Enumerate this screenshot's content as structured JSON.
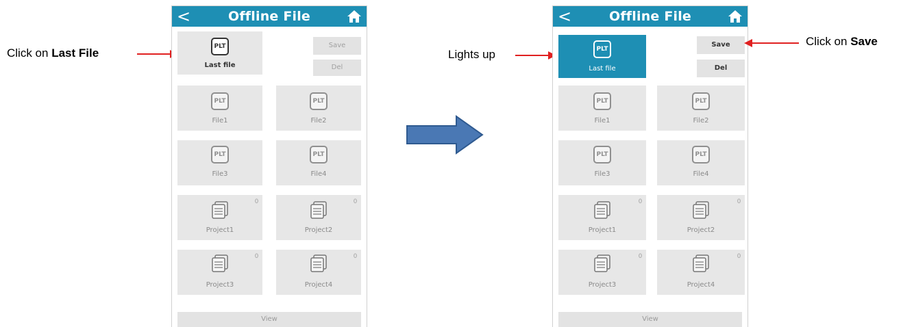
{
  "annotations": {
    "left_prefix": "Click on ",
    "left_bold": "Last File",
    "middle": "Lights up",
    "right_prefix": "Click on ",
    "right_bold": "Save"
  },
  "app": {
    "back_glyph": "<",
    "title": "Offline File",
    "home_icon": "home-icon",
    "last_file": {
      "icon_text": "PLT",
      "label": "Last file"
    },
    "save_label": "Save",
    "del_label": "Del",
    "files": [
      {
        "icon_text": "PLT",
        "label": "File1"
      },
      {
        "icon_text": "PLT",
        "label": "File2"
      },
      {
        "icon_text": "PLT",
        "label": "File3"
      },
      {
        "icon_text": "PLT",
        "label": "File4"
      }
    ],
    "projects": [
      {
        "label": "Project1",
        "count": "0"
      },
      {
        "label": "Project2",
        "count": "0"
      },
      {
        "label": "Project3",
        "count": "0"
      },
      {
        "label": "Project4",
        "count": "0"
      }
    ],
    "view_label": "View"
  },
  "colors": {
    "header": "#1e8fb4",
    "selected_tile": "#1e8fb4",
    "red_arrow": "#e02020",
    "transition_arrow": "#4a78b4"
  }
}
